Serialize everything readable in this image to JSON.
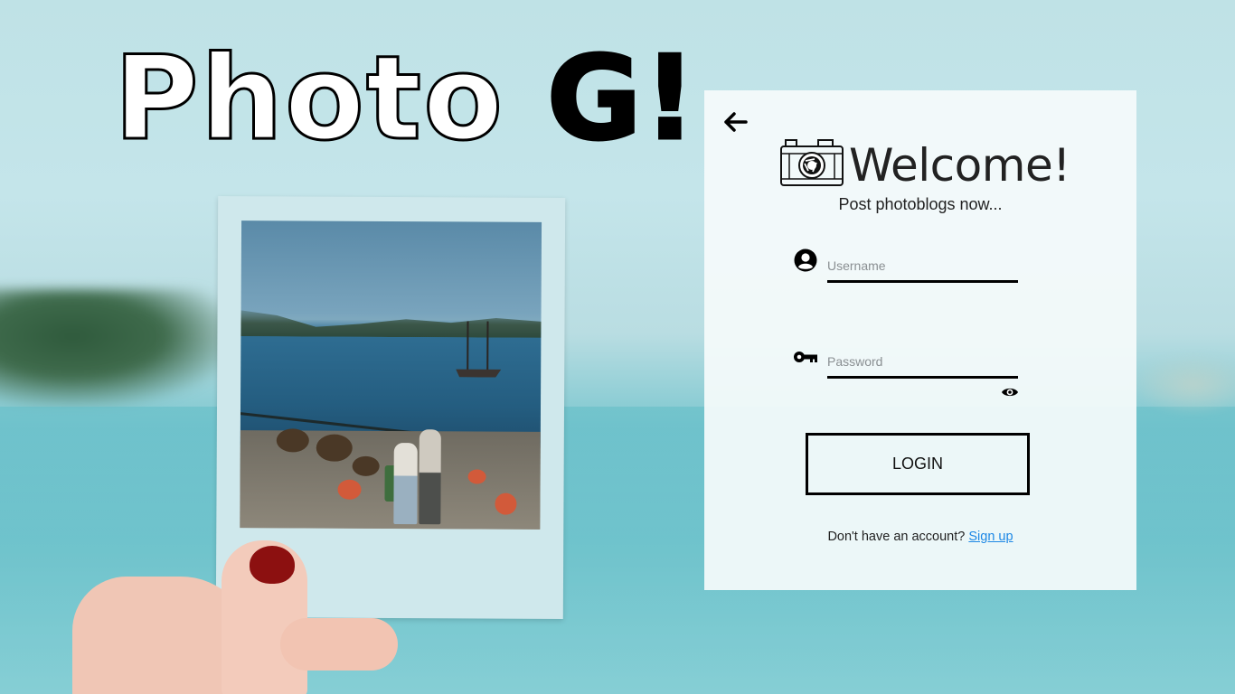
{
  "logo": {
    "part1": "Photo ",
    "part2": "G!"
  },
  "card": {
    "back_icon": "arrow-left-icon",
    "camera_icon": "camera-logo-icon",
    "title": "Welcome!",
    "subtitle": "Post photoblogs now...",
    "username": {
      "icon": "user-circle-icon",
      "placeholder": "Username",
      "value": ""
    },
    "password": {
      "icon": "key-icon",
      "placeholder": "Password",
      "value": "",
      "toggle_icon": "eye-icon"
    },
    "login_label": "LOGIN",
    "signup_prompt": "Don't have an account? ",
    "signup_link": "Sign up"
  },
  "colors": {
    "link": "#1e88e5",
    "card_bg": "#f5fbfb",
    "border": "#000000"
  }
}
